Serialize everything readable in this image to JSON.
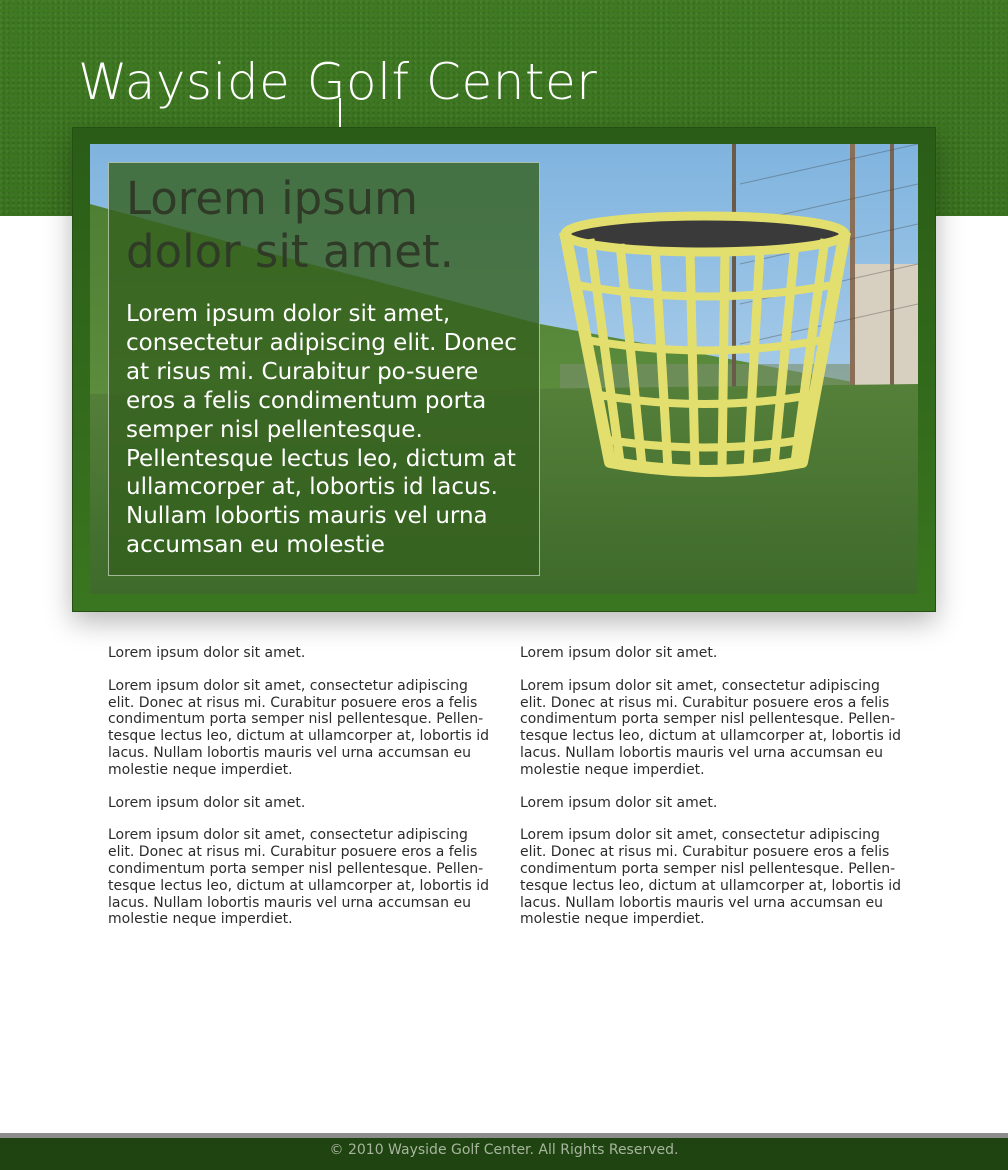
{
  "site": {
    "title": "Wayside Golf Center"
  },
  "hero": {
    "heading": "Lorem ipsum dolor sit amet.",
    "body": "Lorem ipsum dolor sit amet, consectetur adipiscing elit. Donec at risus mi. Curabitur po-suere eros a felis condimentum porta semper nisl pellentesque. Pellentesque lectus leo, dictum at ullamcorper at, lobortis id lacus. Nullam lobortis mauris vel urna accumsan eu molestie"
  },
  "content": {
    "left": {
      "p1": "Lorem ipsum dolor sit amet.",
      "p2": "Lorem ipsum dolor sit amet, consectetur adipiscing elit. Donec at risus mi. Curabitur posuere eros a felis condimentum porta semper nisl pellentesque. Pellen-tesque lectus leo, dictum at ullamcorper at, lobortis id lacus. Nullam lobortis mauris vel urna accumsan eu molestie neque imperdiet.",
      "p3": "Lorem ipsum dolor sit amet.",
      "p4": "Lorem ipsum dolor sit amet, consectetur adipiscing elit. Donec at risus mi. Curabitur posuere eros a felis condimentum porta semper nisl pellentesque. Pellen-tesque lectus leo, dictum at ullamcorper at, lobortis id lacus. Nullam lobortis mauris vel urna accumsan eu molestie neque imperdiet."
    },
    "right": {
      "p1": "Lorem ipsum dolor sit amet.",
      "p2": "Lorem ipsum dolor sit amet, consectetur adipiscing elit. Donec at risus mi. Curabitur posuere eros a felis condimentum porta semper nisl pellentesque. Pellen-tesque lectus leo, dictum at ullamcorper at, lobortis id lacus. Nullam lobortis mauris vel urna accumsan eu molestie neque imperdiet.",
      "p3": "Lorem ipsum dolor sit amet.",
      "p4": "Lorem ipsum dolor sit amet, consectetur adipiscing elit. Donec at risus mi. Curabitur posuere eros a felis condimentum porta semper nisl pellentesque. Pellen-tesque lectus leo, dictum at ullamcorper at, lobortis id lacus. Nullam lobortis mauris vel urna accumsan eu molestie neque imperdiet."
    }
  },
  "footer": {
    "copyright": "© 2010 Wayside Golf Center. All Rights Reserved."
  },
  "colors": {
    "header_green": "#3a731f",
    "frame_green": "#2a5c17",
    "footer_green": "#1f4411",
    "footer_rule": "#8d8d8d",
    "basket_yellow": "#e3df6e"
  }
}
